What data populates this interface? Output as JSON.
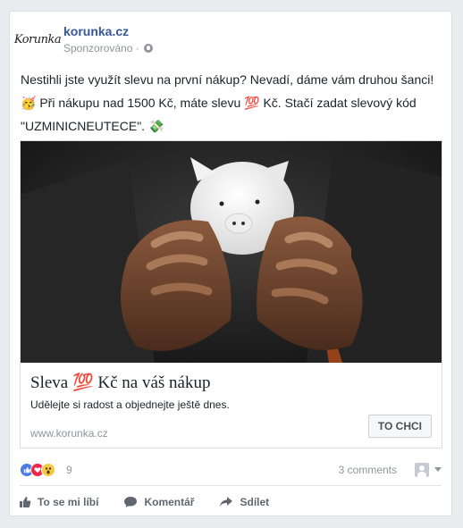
{
  "post": {
    "page_name": "korunka.cz",
    "logo_text": "Korunka",
    "sponsored_label": "Sponzorováno · ",
    "text": "Nestihli jste využít slevu na první nákup? Nevadí, dáme vám druhou šanci! 🥳 Při nákupu nad 1500 Kč, máte slevu 💯 Kč. Stačí zadat slevový kód \"UZMINICNEUTECE\". 💸"
  },
  "ad": {
    "title": "Sleva 💯 Kč na váš nákup",
    "description": "Udělejte si radost a objednejte ještě dnes.",
    "domain": "www.korunka.cz",
    "cta_label": "TO CHCI"
  },
  "stats": {
    "reaction_count": "9",
    "comments": "3 comments"
  },
  "actions": {
    "like": "To se mi líbí",
    "comment": "Komentář",
    "share": "Sdílet"
  },
  "icons": [
    "globe-icon",
    "like-reaction-icon",
    "love-reaction-icon",
    "wow-reaction-icon",
    "chevron-down-icon",
    "thumbs-up-icon",
    "comment-icon",
    "share-icon"
  ],
  "colors": {
    "brand_link": "#365899",
    "secondary_text": "#90949c",
    "background": "#e9ebee"
  }
}
